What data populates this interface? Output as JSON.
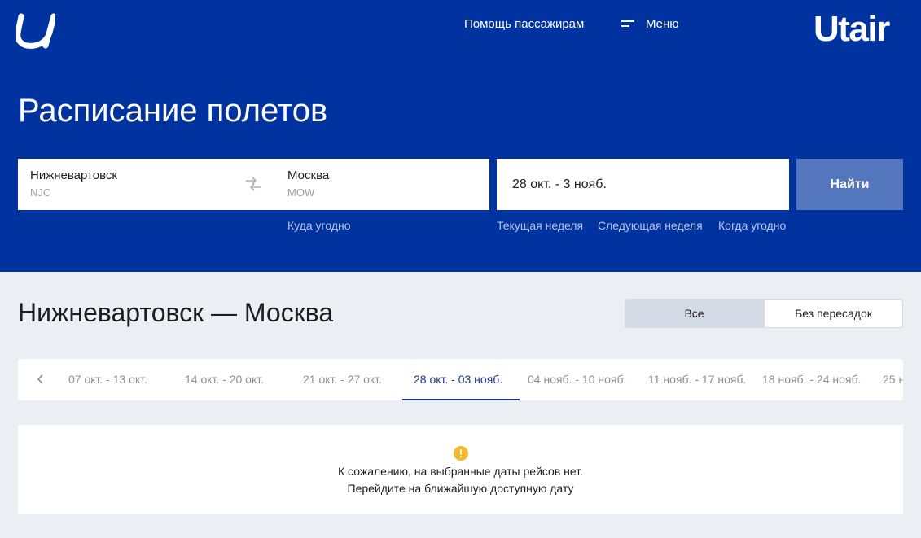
{
  "header": {
    "brand": "Utair",
    "help_label": "Помощь пассажирам",
    "menu_label": "Меню"
  },
  "search": {
    "title": "Расписание полетов",
    "from": {
      "city": "Нижневартовск",
      "code": "NJC"
    },
    "to": {
      "city": "Москва",
      "code": "MOW"
    },
    "anywhere_label": "Куда угодно",
    "date_value": "28 окт. - 3 нояб.",
    "find_label": "Найти",
    "quick_dates": [
      "Текущая неделя",
      "Следующая неделя",
      "Когда угодно"
    ]
  },
  "results": {
    "route_title": "Нижневартовск — Москва",
    "filter": {
      "all_label": "Все",
      "direct_label": "Без пересадок",
      "selected": "Без пересадок"
    },
    "weeks": [
      "07 окт. - 13 окт.",
      "14 окт. - 20 окт.",
      "21 окт. - 27 окт.",
      "28 окт. - 03 нояб.",
      "04 нояб. - 10 нояб.",
      "11 нояб. - 17 нояб.",
      "18 нояб. - 24 нояб.",
      "25 н"
    ],
    "active_week": "28 окт. - 03 нояб.",
    "empty_line1": "К сожалению, на выбранные даты рейсов нет.",
    "empty_line2": "Перейдите на ближайшую доступную дату"
  },
  "icons": {
    "logo": "utair-u-logo",
    "menu": "hamburger-icon",
    "swap": "swap-arrows-icon",
    "prev": "chevron-left-icon",
    "warning": "warning-icon"
  },
  "colors": {
    "brand_blue": "#0133a0",
    "button": "#5476bd",
    "active_tab": "#1d3a8a",
    "warning": "#f5b82e",
    "page_bg": "#ebeef3"
  }
}
